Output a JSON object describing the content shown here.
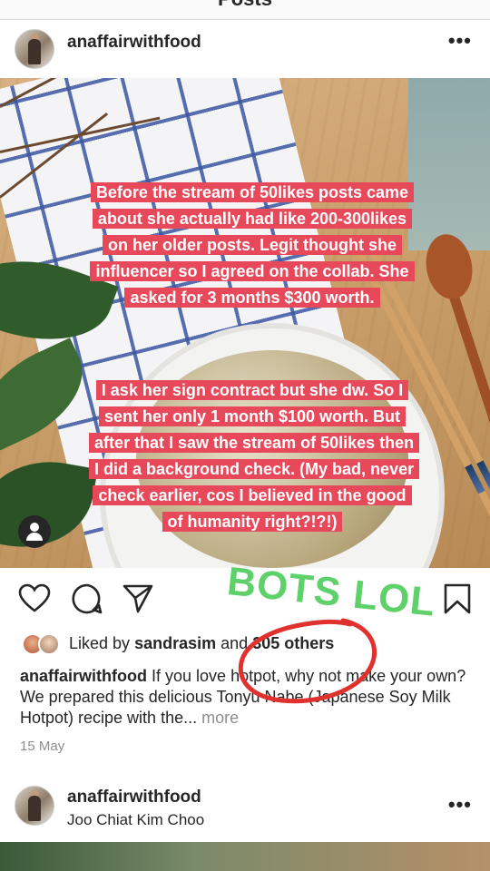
{
  "topbar": {
    "title": "Posts"
  },
  "post1": {
    "username": "anaffairwithfood",
    "menu_icon": "more-dots-icon",
    "image_overlay": {
      "paragraph1": "Before the stream of 50likes posts came about she actually had like 200-300likes on her older posts. Legit thought she influencer so I agreed on the collab. She asked for 3 months $300 worth.",
      "paragraph2": "I ask her sign contract but she dw. So I sent her only 1 month $100 worth. But after that I saw the stream of 50likes then I did a background check. (My bad, never check earlier, cos I believed in the good of humanity right?!?!)"
    },
    "annotation": "BOTS LOL",
    "annotation_color": "#5fd16a",
    "circle_color": "#e0312f",
    "likes": {
      "prefix": "Liked by",
      "user": "sandrasim",
      "joiner": "and",
      "others": "305 others"
    },
    "caption": {
      "user": "anaffairwithfood",
      "text": "If you love hotpot, why not make your own? We prepared this delicious Tonyu Nabe (Japanese Soy Milk Hotpot) recipe with the...",
      "more": "more"
    },
    "date": "15 May"
  },
  "post2": {
    "username": "anaffairwithfood",
    "location": "Joo Chiat Kim Choo"
  },
  "colors": {
    "caption_bg": "#e8495a",
    "muted": "#8e8e8e"
  }
}
